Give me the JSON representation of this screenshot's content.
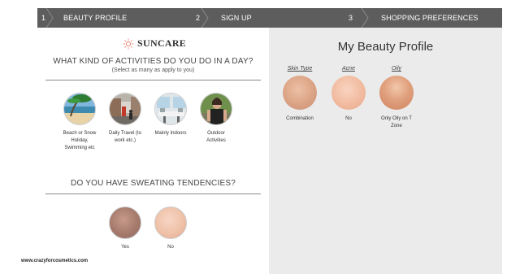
{
  "steps": [
    {
      "num": "1",
      "label": "BEAUTY PROFILE"
    },
    {
      "num": "2",
      "label": "SIGN UP"
    },
    {
      "num": "3",
      "label": "SHOPPING PREFERENCES"
    }
  ],
  "brand": {
    "name": "SUNCARE",
    "icon": "sun-icon"
  },
  "activities": {
    "question": "WHAT KIND OF ACTIVITIES DO YOU DO IN A DAY?",
    "hint": "(Select as many as apply to you)",
    "options": [
      {
        "line1": "Beach or Snow",
        "line2": "Holiday,",
        "line3": "Swimming etc"
      },
      {
        "line1": "Daily Travel (to",
        "line2": "work etc.)",
        "line3": ""
      },
      {
        "line1": "Mainly Indoors",
        "line2": "",
        "line3": ""
      },
      {
        "line1": "Outdoor",
        "line2": "Activities",
        "line3": ""
      }
    ]
  },
  "sweating": {
    "question": "DO YOU HAVE SWEATING TENDENCIES?",
    "options": [
      {
        "label": "Yes"
      },
      {
        "label": "No"
      }
    ]
  },
  "profile": {
    "title": "My Beauty Profile",
    "columns": [
      {
        "header": "Skin Type",
        "value1": "Combination",
        "value2": ""
      },
      {
        "header": "Acne",
        "value1": "No",
        "value2": ""
      },
      {
        "header": "Oily",
        "value1": "Only Oily on T",
        "value2": "Zone"
      }
    ]
  },
  "credit": "www.crazyforcosmetics.com",
  "colors": {
    "stepbar": "#5d5d5d",
    "right_panel": "#ebebeb"
  }
}
